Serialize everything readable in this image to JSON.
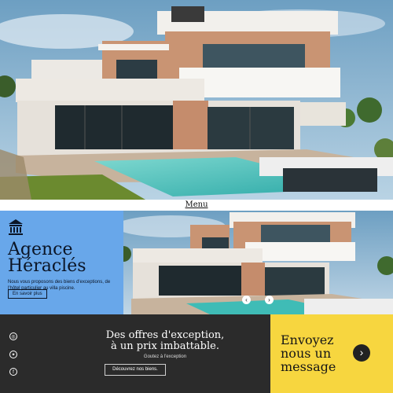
{
  "menu": {
    "label": "Menu"
  },
  "agency": {
    "icon": "building-columns-icon",
    "name_line1": "Agence",
    "name_line2": "Héraclés",
    "description": "Nous vous proposons des biens d'exceptions, de l'hôtel particulier au villa piscine.",
    "button_label": "En savoir plus"
  },
  "slider": {
    "prev_icon": "chevron-left-icon",
    "next_icon": "chevron-right-icon"
  },
  "footer": {
    "social": [
      "instagram-icon",
      "twitter-icon",
      "facebook-icon"
    ],
    "offer_line1": "Des offres d'exception,",
    "offer_line2": "à un prix imbattable.",
    "offer_subtitle": "Goutez à l'exception",
    "offer_button": "Découvrez nos biens."
  },
  "cta": {
    "line1": "Envoyez",
    "line2": "nous un",
    "line3": "message",
    "icon": "chevron-right-circle-icon"
  },
  "colors": {
    "agency_bg": "#68a7ea",
    "footer_bg": "#2b2b2b",
    "cta_bg": "#f7d63f",
    "pool": "#3fbcb6"
  }
}
